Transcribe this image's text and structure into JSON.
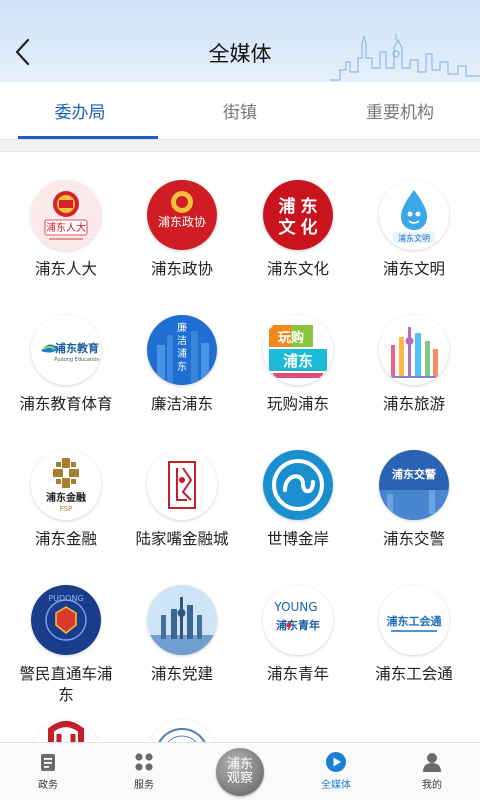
{
  "header": {
    "title": "全媒体"
  },
  "tabs": [
    {
      "label": "委办局",
      "active": true
    },
    {
      "label": "街镇",
      "active": false
    },
    {
      "label": "重要机构",
      "active": false
    }
  ],
  "grid": [
    {
      "label": "浦东人大",
      "icon": "npc-emblem-icon"
    },
    {
      "label": "浦东政协",
      "icon": "cppcc-emblem-icon"
    },
    {
      "label": "浦东文化",
      "icon": "culture-logo-icon"
    },
    {
      "label": "浦东文明",
      "icon": "civilization-mascot-icon"
    },
    {
      "label": "浦东教育体育",
      "icon": "education-logo-icon"
    },
    {
      "label": "廉洁浦东",
      "icon": "clean-pudong-icon"
    },
    {
      "label": "玩购浦东",
      "icon": "shopping-pudong-icon"
    },
    {
      "label": "浦东旅游",
      "icon": "tourism-skyline-icon"
    },
    {
      "label": "浦东金融",
      "icon": "finance-logo-icon"
    },
    {
      "label": "陆家嘴金融城",
      "icon": "lujiazui-logo-icon"
    },
    {
      "label": "世博金岸",
      "icon": "expo-logo-icon"
    },
    {
      "label": "浦东交警",
      "icon": "traffic-police-icon"
    },
    {
      "label": "警民直通车浦东",
      "icon": "police-badge-icon"
    },
    {
      "label": "浦东党建",
      "icon": "party-building-icon"
    },
    {
      "label": "浦东青年",
      "icon": "youth-logo-icon"
    },
    {
      "label": "浦东工会通",
      "icon": "union-logo-icon"
    },
    {
      "label": "",
      "icon": "partial-logo-icon"
    },
    {
      "label": "",
      "icon": "partial-seal-icon"
    }
  ],
  "logo_text": {
    "npc": "浦东人大",
    "cppcc": "浦东政协",
    "culture": [
      "浦",
      "东",
      "文",
      "化"
    ],
    "civil": "浦东文明",
    "edu_main": "浦东教育",
    "edu_sub": "Pudong Education",
    "clean": [
      "廉",
      "洁",
      "浦",
      "东"
    ],
    "shop_top": "玩购",
    "shop_main": "浦东",
    "finance_main": "浦东金融",
    "finance_sub": "FSP",
    "traffic": "浦东交警",
    "police": "PUDONG",
    "youth_top": "YOUNG",
    "youth_main": "浦东青年",
    "union": "浦东工会通"
  },
  "bottom_nav": [
    {
      "label": "政务",
      "icon": "government-icon",
      "active": false
    },
    {
      "label": "服务",
      "icon": "services-grid-icon",
      "active": false
    },
    {
      "label": "浦东观察",
      "icon": "pudong-observer-logo",
      "active": false,
      "center": true
    },
    {
      "label": "全媒体",
      "icon": "play-icon",
      "active": true
    },
    {
      "label": "我的",
      "icon": "profile-icon",
      "active": false
    }
  ],
  "colors": {
    "accent": "#1a5fc4",
    "nav_active": "#1a7fd6",
    "header_bg": "#d6e7f8"
  }
}
